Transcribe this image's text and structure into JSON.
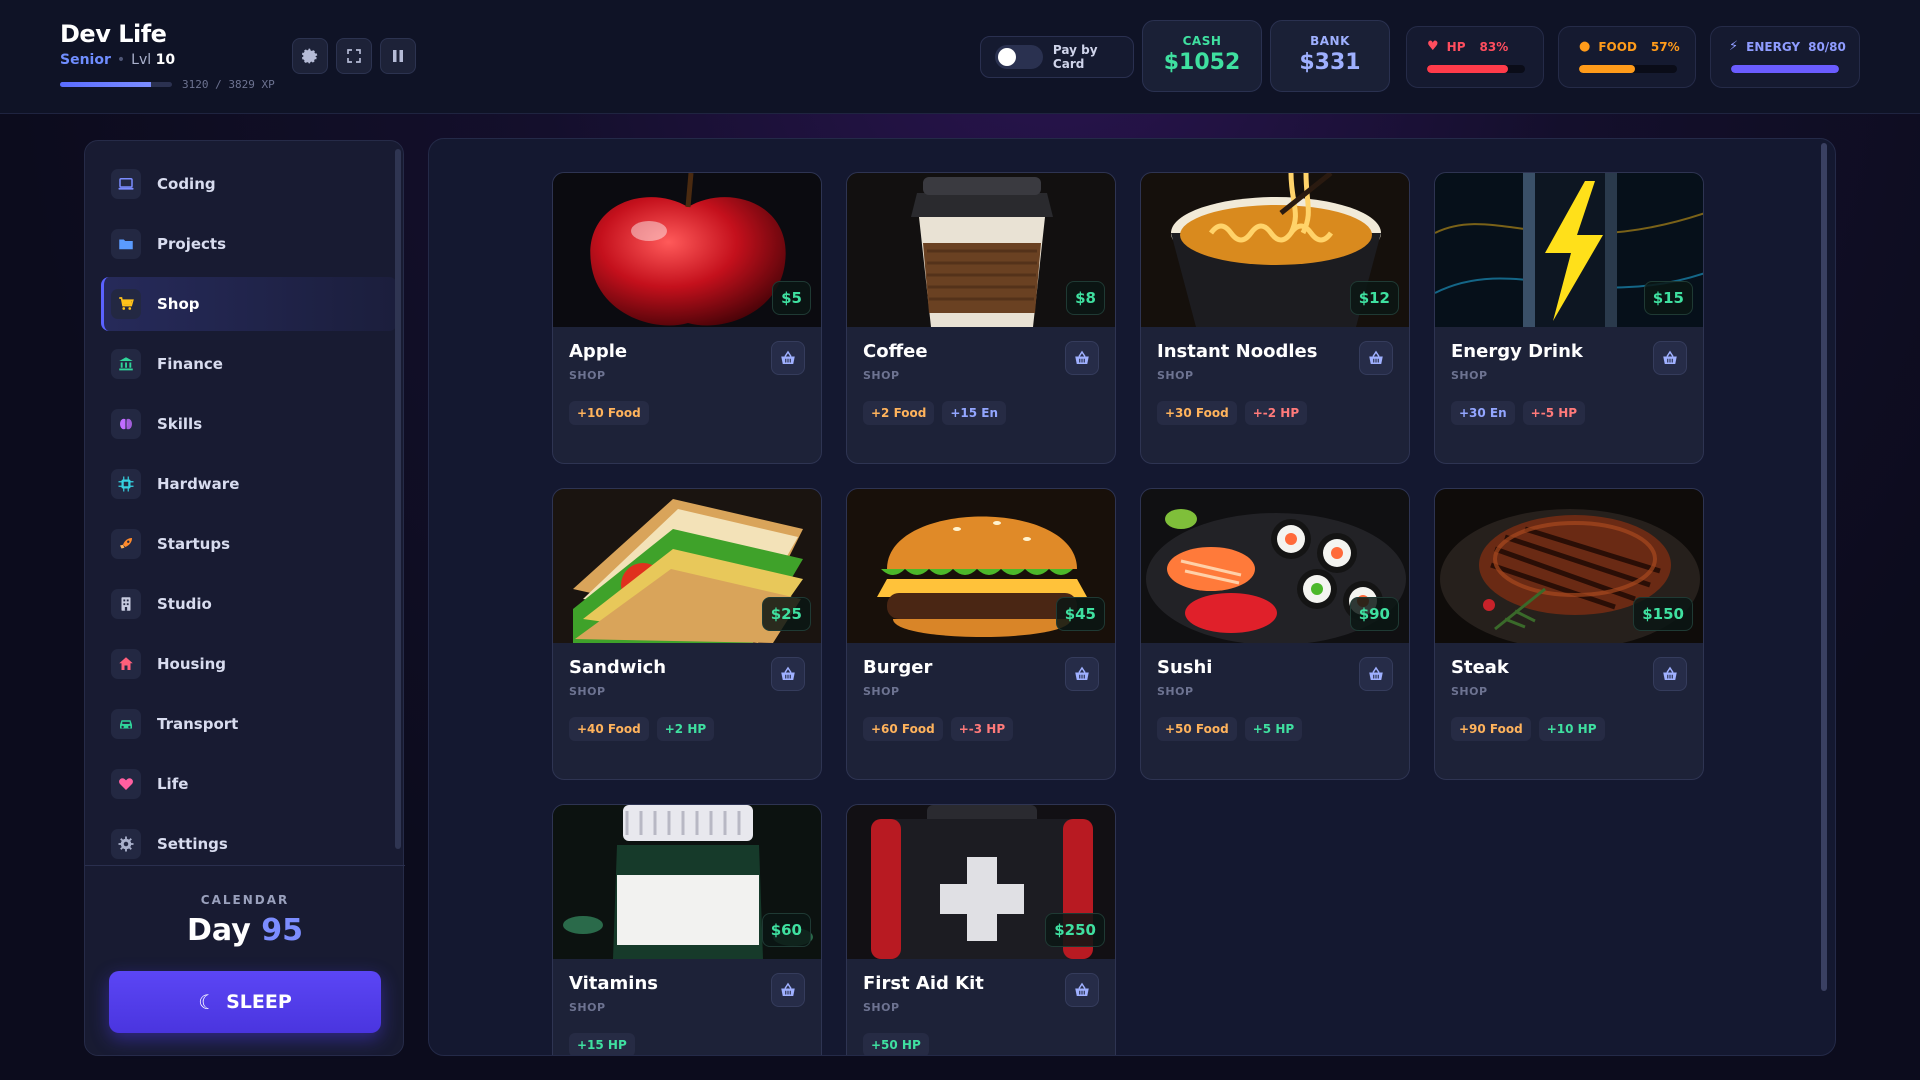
{
  "header": {
    "app_title": "Dev Life",
    "rank": "Senior",
    "level_label": "Lvl",
    "level": "10",
    "xp_text": "3120 / 3829 XP",
    "xp_progress": 0.815,
    "pay_by_card_label": "Pay by Card",
    "pay_by_card_on": false,
    "cash_label": "CASH",
    "cash_value": "$1052",
    "bank_label": "BANK",
    "bank_value": "$331",
    "stats": [
      {
        "label": "HP",
        "value": "83%",
        "fraction": 0.83,
        "color": "#ff3b4a",
        "icon": "heart-icon"
      },
      {
        "label": "FOOD",
        "value": "57%",
        "fraction": 0.57,
        "color": "#ff9b1a",
        "icon": "food-icon"
      },
      {
        "label": "ENERGY",
        "value": "80/80",
        "fraction": 1.0,
        "color": "#6a5cff",
        "icon": "lightning-icon"
      }
    ]
  },
  "sidebar": {
    "items": [
      {
        "label": "Coding",
        "icon": "laptop-icon",
        "active": false
      },
      {
        "label": "Projects",
        "icon": "folder-icon",
        "active": false
      },
      {
        "label": "Shop",
        "icon": "cart-icon",
        "active": true
      },
      {
        "label": "Finance",
        "icon": "bank-icon",
        "active": false
      },
      {
        "label": "Skills",
        "icon": "brain-icon",
        "active": false
      },
      {
        "label": "Hardware",
        "icon": "chip-icon",
        "active": false
      },
      {
        "label": "Startups",
        "icon": "rocket-icon",
        "active": false
      },
      {
        "label": "Studio",
        "icon": "building-icon",
        "active": false
      },
      {
        "label": "Housing",
        "icon": "house-icon",
        "active": false
      },
      {
        "label": "Transport",
        "icon": "car-icon",
        "active": false
      },
      {
        "label": "Life",
        "icon": "heart-icon",
        "active": false
      },
      {
        "label": "Settings",
        "icon": "gear-icon",
        "active": false
      }
    ],
    "calendar_label": "CALENDAR",
    "day_label": "Day",
    "day_value": "95",
    "sleep_label": "SLEEP"
  },
  "shop": {
    "items": [
      {
        "name": "Apple",
        "category": "SHOP",
        "price": "$5",
        "image": "apple",
        "tags": [
          {
            "text": "+10 Food",
            "kind": "food"
          }
        ]
      },
      {
        "name": "Coffee",
        "category": "SHOP",
        "price": "$8",
        "image": "coffee",
        "tags": [
          {
            "text": "+2 Food",
            "kind": "food"
          },
          {
            "text": "+15 En",
            "kind": "en"
          }
        ]
      },
      {
        "name": "Instant Noodles",
        "category": "SHOP",
        "price": "$12",
        "image": "noodles",
        "tags": [
          {
            "text": "+30 Food",
            "kind": "food"
          },
          {
            "text": "+-2 HP",
            "kind": "neg"
          }
        ]
      },
      {
        "name": "Energy Drink",
        "category": "SHOP",
        "price": "$15",
        "image": "energy",
        "tags": [
          {
            "text": "+30 En",
            "kind": "en"
          },
          {
            "text": "+-5 HP",
            "kind": "neg"
          }
        ]
      },
      {
        "name": "Sandwich",
        "category": "SHOP",
        "price": "$25",
        "image": "sandwich",
        "tags": [
          {
            "text": "+40 Food",
            "kind": "food"
          },
          {
            "text": "+2 HP",
            "kind": "hp"
          }
        ]
      },
      {
        "name": "Burger",
        "category": "SHOP",
        "price": "$45",
        "image": "burger",
        "tags": [
          {
            "text": "+60 Food",
            "kind": "food"
          },
          {
            "text": "+-3 HP",
            "kind": "neg"
          }
        ]
      },
      {
        "name": "Sushi",
        "category": "SHOP",
        "price": "$90",
        "image": "sushi",
        "tags": [
          {
            "text": "+50 Food",
            "kind": "food"
          },
          {
            "text": "+5 HP",
            "kind": "hp"
          }
        ]
      },
      {
        "name": "Steak",
        "category": "SHOP",
        "price": "$150",
        "image": "steak",
        "tags": [
          {
            "text": "+90 Food",
            "kind": "food"
          },
          {
            "text": "+10 HP",
            "kind": "hp"
          }
        ]
      },
      {
        "name": "Vitamins",
        "category": "SHOP",
        "price": "$60",
        "image": "vitamins",
        "tags": [
          {
            "text": "+15 HP",
            "kind": "hp"
          }
        ]
      },
      {
        "name": "First Aid Kit",
        "category": "SHOP",
        "price": "$250",
        "image": "firstaid",
        "tags": [
          {
            "text": "+50 HP",
            "kind": "hp"
          }
        ]
      }
    ]
  },
  "colors": {
    "accent": "#5b46f5",
    "cash": "#3fe0a0",
    "bank": "#9fb0ff"
  }
}
